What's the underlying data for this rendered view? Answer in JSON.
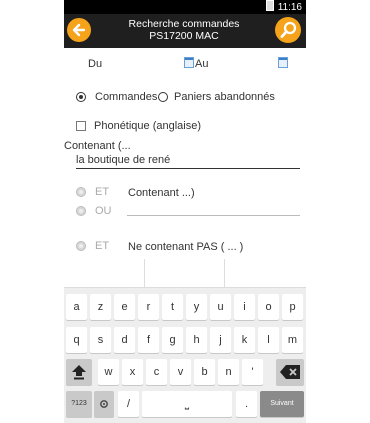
{
  "status": {
    "time": "11:16"
  },
  "header": {
    "title_line1": "Recherche commandes",
    "title_line2": "PS17200 MAC",
    "back_icon": "arrow-left-icon",
    "search_icon": "search-icon"
  },
  "dates": {
    "from_label": "Du",
    "to_label": "Au"
  },
  "type": {
    "option1": "Commandes",
    "option2": "Paniers abandonnés"
  },
  "phonetic": {
    "label": "Phonétique (anglaise)"
  },
  "contains": {
    "label": "Contenant (...",
    "value": "la boutique de rené"
  },
  "logic": {
    "et": "ET",
    "ou": "OU",
    "contains2_label": "Contenant ...)",
    "not_contains_label": "Ne contenant PAS ( ... )"
  },
  "keyboard": {
    "row1": [
      "a",
      "z",
      "e",
      "r",
      "t",
      "y",
      "u",
      "i",
      "o",
      "p"
    ],
    "row2": [
      "q",
      "s",
      "d",
      "f",
      "g",
      "h",
      "j",
      "k",
      "l",
      "m"
    ],
    "row3": [
      "w",
      "x",
      "c",
      "v",
      "b",
      "n",
      "'"
    ],
    "key_123": "?123",
    "key_slash": "/",
    "key_dot": ".",
    "key_space": "⎵",
    "key_next": "Suivant"
  }
}
